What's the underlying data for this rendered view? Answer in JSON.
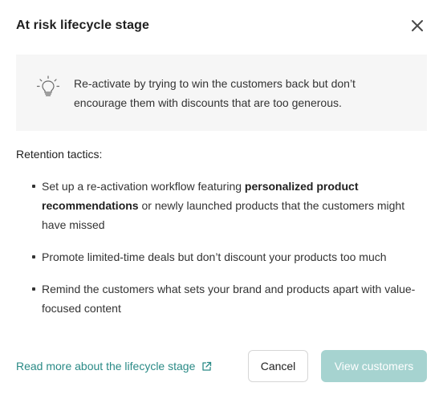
{
  "dialog": {
    "title": "At risk lifecycle stage",
    "close_icon": "close-icon"
  },
  "tip": {
    "icon": "lightbulb-icon",
    "text": "Re-activate by trying to win the customers back but don’t encourage them with discounts that are too generous."
  },
  "tactics": {
    "label": "Retention tactics:",
    "items": [
      {
        "before": "Set up a re-activation workflow featuring ",
        "bold": "personalized product recommendations",
        "after": " or newly launched products that the customers might have missed"
      },
      {
        "before": "Promote limited-time deals but don’t discount your products too much",
        "bold": "",
        "after": ""
      },
      {
        "before": "Remind the customers what sets your brand and products apart with value-focused content",
        "bold": "",
        "after": ""
      }
    ]
  },
  "footer": {
    "link_label": "Read more about the lifecycle stage",
    "link_icon": "external-link-icon",
    "cancel_label": "Cancel",
    "primary_label": "View customers"
  },
  "colors": {
    "accent": "#2a8a86",
    "primary_disabled": "#a6d3d0",
    "tip_background": "#f6f6f6"
  }
}
